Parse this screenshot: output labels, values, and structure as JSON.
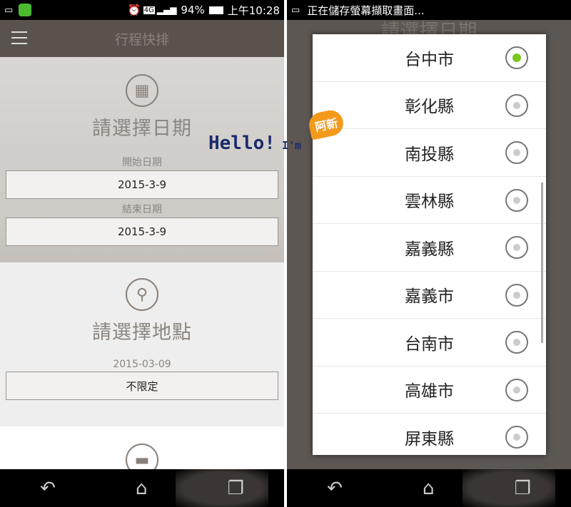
{
  "left": {
    "status": {
      "time": "上午10:28",
      "battery": "94%",
      "network": "4G"
    },
    "appbar": {
      "title": "行程快排"
    },
    "date_section": {
      "title": "請選擇日期",
      "start_label": "開始日期",
      "start_value": "2015-3-9",
      "end_label": "結束日期",
      "end_value": "2015-3-9"
    },
    "place_section": {
      "title": "請選擇地點",
      "date": "2015-03-09",
      "place_value": "不限定"
    }
  },
  "right": {
    "status": {
      "notification": "正在儲存螢幕擷取畫面..."
    },
    "background_title": "請選擇日期",
    "options": [
      {
        "label": "台中市",
        "selected": true
      },
      {
        "label": "彰化縣",
        "selected": false
      },
      {
        "label": "南投縣",
        "selected": false
      },
      {
        "label": "雲林縣",
        "selected": false
      },
      {
        "label": "嘉義縣",
        "selected": false
      },
      {
        "label": "嘉義市",
        "selected": false
      },
      {
        "label": "台南市",
        "selected": false
      },
      {
        "label": "高雄市",
        "selected": false
      },
      {
        "label": "屏東縣",
        "selected": false
      }
    ]
  },
  "watermark": {
    "text": "Hello! I'm",
    "bubble": "阿新"
  },
  "colors": {
    "appbar": "#5a524d",
    "accent_radio": "#7bc51f"
  }
}
